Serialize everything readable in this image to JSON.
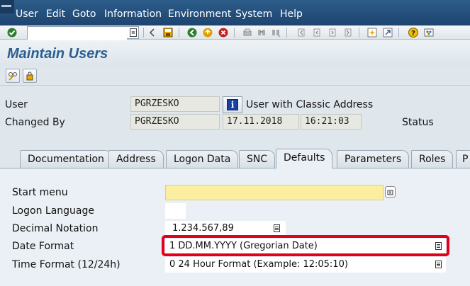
{
  "menu": {
    "items": [
      "User",
      "Edit",
      "Goto",
      "Information",
      "Environment",
      "System",
      "Help"
    ]
  },
  "toolbar": {
    "command_value": "",
    "icons": [
      "enter-icon",
      "back-nav-icon",
      "save-icon",
      "back-icon",
      "exit-icon",
      "cancel-icon",
      "print-icon",
      "find-icon",
      "find-next-icon",
      "first-page-icon",
      "previous-page-icon",
      "next-page-icon",
      "last-page-icon",
      "create-session-icon",
      "shortcut-icon",
      "help-icon",
      "layout-icon"
    ]
  },
  "title": "Maintain Users",
  "header": {
    "user_label": "User",
    "user_value": "PGRZESKO",
    "address_type": "User with Classic Address",
    "changed_by_label": "Changed By",
    "changed_by_value": "PGRZESKO",
    "changed_date": "17.11.2018",
    "changed_time": "16:21:03",
    "status_label": "Status"
  },
  "tabs": [
    {
      "label": "Documentation"
    },
    {
      "label": "Address"
    },
    {
      "label": "Logon Data"
    },
    {
      "label": "SNC"
    },
    {
      "label": "Defaults",
      "active": true
    },
    {
      "label": "Parameters"
    },
    {
      "label": "Roles"
    },
    {
      "label": "P"
    }
  ],
  "defaults": {
    "start_menu_label": "Start menu",
    "start_menu_value": "",
    "logon_language_label": "Logon Language",
    "logon_language_value": "",
    "decimal_notation_label": "Decimal Notation",
    "decimal_notation_value": "1.234.567,89",
    "date_format_label": "Date Format",
    "date_format_value": "1 DD.MM.YYYY (Gregorian Date)",
    "time_format_label": "Time Format (12/24h)",
    "time_format_value": "0 24 Hour Format (Example: 12:05:10)"
  },
  "colors": {
    "menubar": "#1d4470",
    "title": "#2b5f91",
    "required_field": "#fbeea0",
    "highlight": "#e3001b"
  }
}
